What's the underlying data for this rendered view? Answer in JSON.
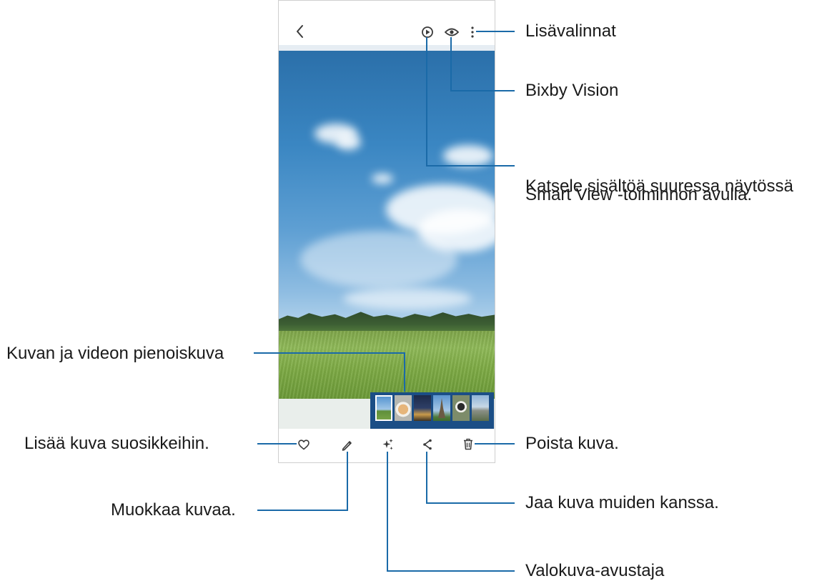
{
  "colors": {
    "callout_line": "#1a6aa8",
    "thumbnail_strip": "#1b4e86",
    "icon": "#3a3a3a"
  },
  "top_bar": {
    "icons": [
      "back-icon",
      "smart-view-icon",
      "bixby-vision-icon",
      "more-options-icon"
    ]
  },
  "thumbnails": [
    "landscape",
    "dog",
    "night-city",
    "eiffel-tower",
    "dog-portrait",
    "castle"
  ],
  "bottom_bar": {
    "icons": [
      "heart-icon",
      "edit-pencil-icon",
      "photo-assistant-icon",
      "share-icon",
      "trash-icon"
    ]
  },
  "callouts": {
    "more_options": "Lisävalinnat",
    "bixby_vision": "Bixby Vision",
    "smart_view_line1": "Katsele sisältöä suuressa näytössä",
    "smart_view_line2": "Smart View -toiminnon avulla.",
    "thumbnail": "Kuvan ja videon pienoiskuva",
    "favourite": "Lisää kuva suosikkeihin.",
    "delete": "Poista kuva.",
    "edit": "Muokkaa kuvaa.",
    "share": "Jaa kuva muiden kanssa.",
    "assistant": "Valokuva-avustaja"
  }
}
